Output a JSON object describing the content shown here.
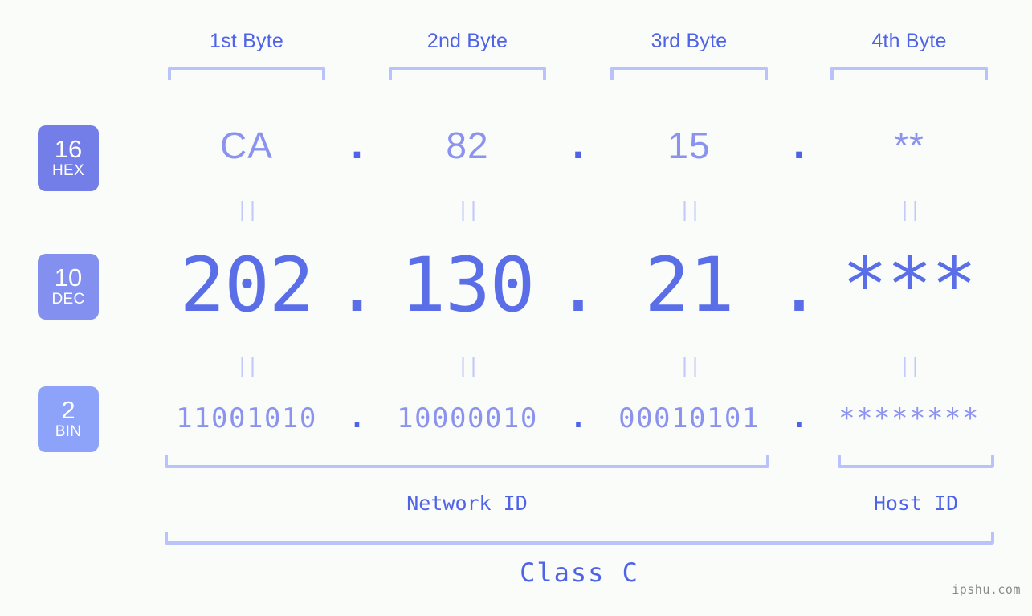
{
  "meta": {
    "background": "#fafcfa",
    "accent_strong": "#4f63e8",
    "accent_light": "#8b93ef",
    "bracket_color": "#b9c2fb",
    "eq_color": "#c3cafb"
  },
  "byte_headers": [
    {
      "label": "1st Byte"
    },
    {
      "label": "2nd Byte"
    },
    {
      "label": "3rd Byte"
    },
    {
      "label": "4th Byte"
    }
  ],
  "bases": [
    {
      "number": "16",
      "name": "HEX",
      "color": "#737ee8"
    },
    {
      "number": "10",
      "name": "DEC",
      "color": "#8490f0"
    },
    {
      "number": "2",
      "name": "BIN",
      "color": "#8da3f9"
    }
  ],
  "rows": {
    "hex": {
      "base_number": "16",
      "base_name": "HEX",
      "values": [
        "CA",
        "82",
        "15",
        "**"
      ],
      "separator": "."
    },
    "dec": {
      "base_number": "10",
      "base_name": "DEC",
      "values": [
        "202",
        "130",
        "21",
        "***"
      ],
      "separator": "."
    },
    "bin": {
      "base_number": "2",
      "base_name": "BIN",
      "values": [
        "11001010",
        "10000010",
        "00010101",
        "********"
      ],
      "separator": "."
    }
  },
  "equality_marks": {
    "symbol": "||",
    "count_per_row": 4
  },
  "segments": {
    "network_id": "Network ID",
    "host_id": "Host ID"
  },
  "class": {
    "label": "Class C"
  },
  "watermark": {
    "text": "ipshu.com"
  },
  "chart_data": {
    "type": "table",
    "title": "Class C IP address byte breakdown",
    "categories": [
      "1st Byte",
      "2nd Byte",
      "3rd Byte",
      "4th Byte"
    ],
    "series": [
      {
        "name": "HEX",
        "values": [
          "CA",
          "82",
          "15",
          "**"
        ]
      },
      {
        "name": "DEC",
        "values": [
          "202",
          "130",
          "21",
          "***"
        ]
      },
      {
        "name": "BIN",
        "values": [
          "11001010",
          "10000010",
          "00010101",
          "********"
        ]
      }
    ],
    "annotations": [
      {
        "text": "Network ID",
        "spans_bytes": [
          1,
          2,
          3
        ]
      },
      {
        "text": "Host ID",
        "spans_bytes": [
          4
        ]
      },
      {
        "text": "Class C",
        "spans_bytes": [
          1,
          2,
          3,
          4
        ]
      }
    ],
    "legend": [
      "16 HEX",
      "10 DEC",
      "2 BIN"
    ],
    "grid": false
  }
}
